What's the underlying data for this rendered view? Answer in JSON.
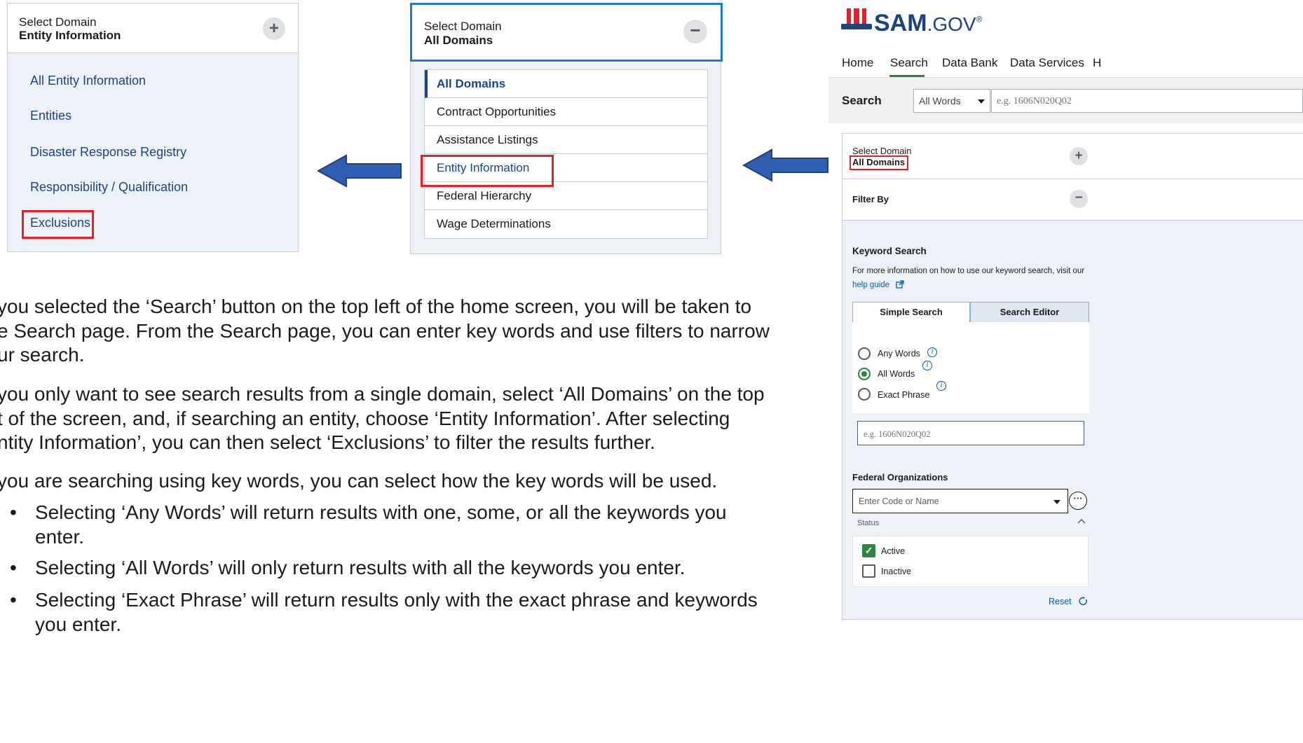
{
  "panel_entity": {
    "header_label": "Select Domain",
    "header_value": "Entity Information",
    "toggle_symbol": "+",
    "items": [
      "All Entity Information",
      "Entities",
      "Disaster Response Registry",
      "Responsibility / Qualification",
      "Exclusions"
    ]
  },
  "panel_domains": {
    "header_label": "Select Domain",
    "header_value": "All Domains",
    "toggle_symbol": "−",
    "items": [
      "All Domains",
      "Contract Opportunities",
      "Assistance Listings",
      "Entity Information",
      "Federal Hierarchy",
      "Wage Determinations"
    ]
  },
  "instructions": {
    "p1": [
      "you selected the ‘Search’ button on the top left of the home screen, you will be taken to",
      "e Search page. From the Search page, you can enter key words and use filters to narrow",
      "ur search."
    ],
    "p2": [
      "you only want to see search results from a single domain, select ‘All Domains’ on the top",
      "t of the screen, and, if searching an entity, choose ‘Entity Information’. After selecting",
      "ntity Information’, you can then select ‘Exclusions’ to filter the results further."
    ],
    "p3": "you are searching using key words, you can select how the key words will be used.",
    "bullet_symbol": "•",
    "bullets": [
      [
        "Selecting ‘Any Words’ will return results with one, some, or all the keywords you",
        "enter."
      ],
      [
        "Selecting ‘All Words’ will only return results with all the keywords you enter."
      ],
      [
        "Selecting ‘Exact Phrase’ will return results only with the exact phrase and keywords",
        "you enter."
      ]
    ]
  },
  "sam": {
    "logo_main": "SAM",
    "logo_suffix": ".GOV",
    "logo_mark": "®",
    "nav": [
      "Home",
      "Search",
      "Data Bank",
      "Data Services",
      "H"
    ],
    "active_nav": "Search",
    "search_label": "Search",
    "search_mode": "All Words",
    "search_placeholder": "e.g. 1606N020Q02",
    "domain_label": "Select Domain",
    "domain_value": "All Domains",
    "filter_by": "Filter By",
    "keyword_search": "Keyword Search",
    "help_text": "For more information on how to use our keyword search, visit our",
    "help_link": "help guide",
    "tabs": [
      "Simple Search",
      "Search Editor"
    ],
    "radio_options": [
      "Any Words",
      "All Words",
      "Exact Phrase"
    ],
    "radio_selected": "All Words",
    "keyword_placeholder": "e.g. 1606N020Q02",
    "federal_orgs": "Federal Organizations",
    "org_placeholder": "Enter Code or Name",
    "status_label": "Status",
    "status_options": [
      "Active",
      "Inactive"
    ],
    "reset": "Reset"
  },
  "colors": {
    "highlight_red": "#e2202a",
    "arrow_blue": "#2f5fb3",
    "link_navy": "#1a4480",
    "active_green": "#2e8540"
  }
}
